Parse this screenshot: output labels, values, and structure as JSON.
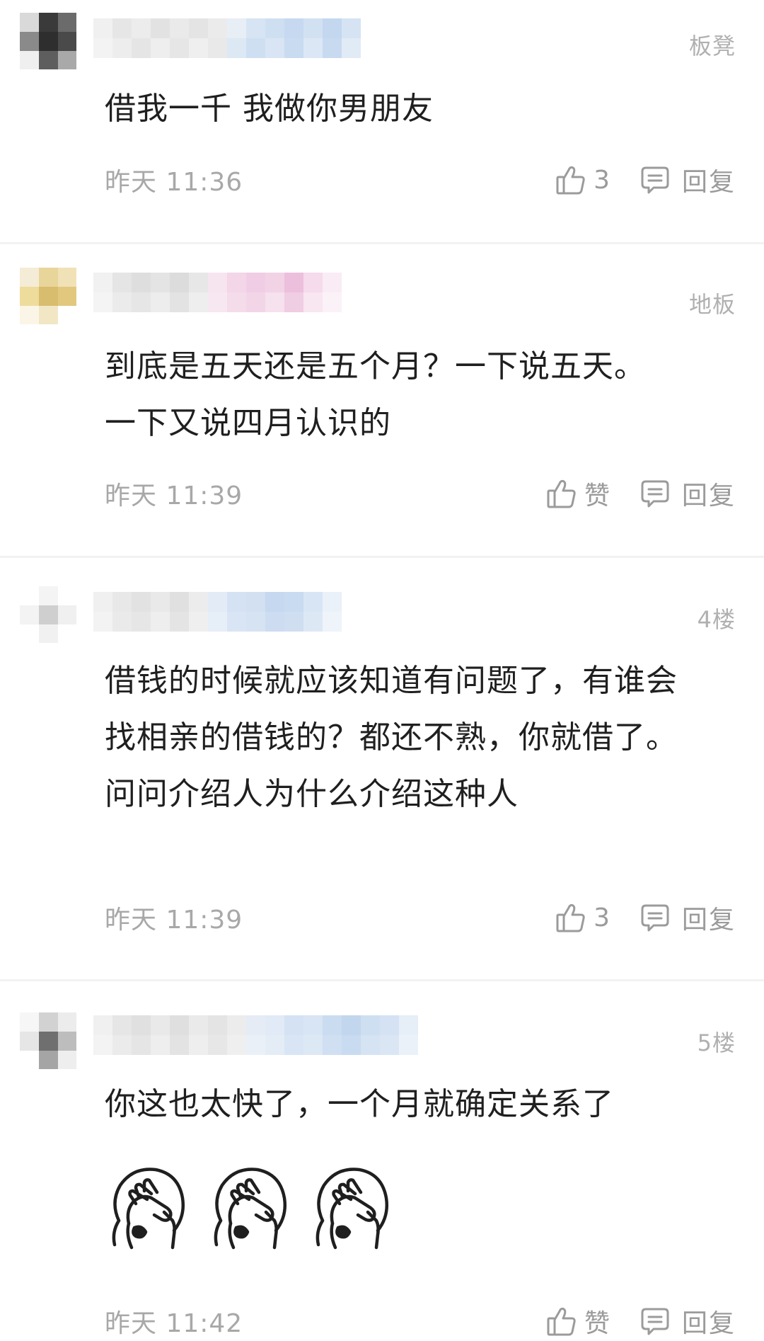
{
  "comments": [
    {
      "floor": "板凳",
      "text": "借我一千 我做你男朋友",
      "time": "昨天 11:36",
      "like_label": "3",
      "reply_label": "回复"
    },
    {
      "floor": "地板",
      "text": "到底是五天还是五个月？一下说五天。一下又说四月认识的",
      "time": "昨天 11:39",
      "like_label": "赞",
      "reply_label": "回复"
    },
    {
      "floor": "4楼",
      "text": "借钱的时候就应该知道有问题了，有谁会找相亲的借钱的？都还不熟，你就借了。问问介绍人为什么介绍这种人",
      "time": "昨天 11:39",
      "like_label": "3",
      "reply_label": "回复"
    },
    {
      "floor": "5楼",
      "text": "你这也太快了，一个月就确定关系了",
      "time": "昨天 11:42",
      "like_label": "赞",
      "reply_label": "回复",
      "stickers": [
        "facepalm-sticker",
        "facepalm-sticker",
        "facepalm-sticker"
      ]
    }
  ],
  "colors": {
    "text": "#1f1f1f",
    "meta": "#a8a8a8",
    "icon": "#9b9b9b",
    "divider": "#f2f2f2"
  },
  "icons": {
    "like": "thumbs-up-icon",
    "reply": "comment-bubble-icon",
    "sticker": "facepalm-sticker"
  }
}
